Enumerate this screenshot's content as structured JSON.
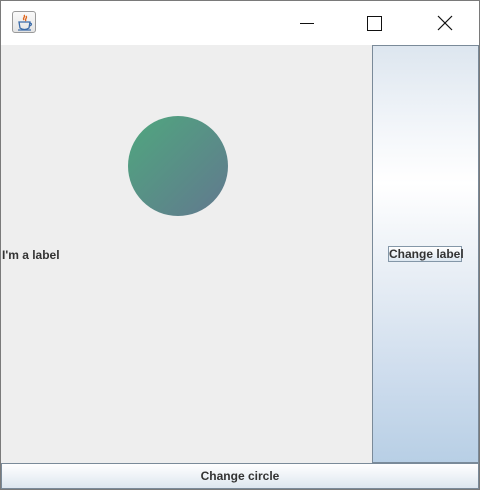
{
  "window": {
    "app_icon": "java-cup-icon",
    "controls": [
      "minimize-icon",
      "maximize-icon",
      "close-icon"
    ]
  },
  "main": {
    "label_text": "I'm a label",
    "circle_colors": [
      "#4fa77e",
      "#62788f"
    ]
  },
  "side_panel": {
    "change_label_button": "Change label"
  },
  "footer": {
    "change_circle_button": "Change circle"
  }
}
